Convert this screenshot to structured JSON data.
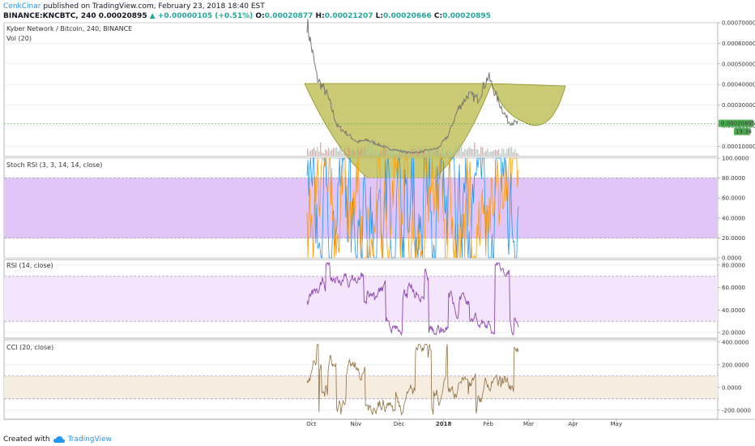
{
  "header": {
    "user": "CenkCinar",
    "published": "published on TradingView.com, February 23, 2018 18:40 EST",
    "symbol": "BINANCE:KNCBTC, 240",
    "change_arrow": "▲",
    "change": "+0.00000105 (+0.51%)",
    "last": "0.00020895",
    "o_label": "O:",
    "o": "0.00020877",
    "h_label": "H:",
    "h": "0.00021207",
    "l_label": "L:",
    "l": "0.00020666",
    "c_label": "C:",
    "c": "0.00020895"
  },
  "panes": {
    "price_title": "Kyber Network / Bitcoin, 240, BINANCE",
    "vol_title": "Vol (20)",
    "stoch_title": "Stoch RSI (3, 3, 14, 14, close)",
    "rsi_title": "RSI (14, close)",
    "cci_title": "CCI (20, close)"
  },
  "badges": {
    "price": "0.00020895",
    "time": "19:34"
  },
  "footer": {
    "created": "Created with",
    "brand": "TradingView"
  },
  "colors": {
    "price_line": "#777777",
    "cup_fill": "#b5b53c",
    "stoch_band": "#e2c5f7",
    "rsi_band": "#f3e5fb",
    "cci_band": "#f5ede0",
    "stoch_k": "#2196f3",
    "stoch_d": "#ff9800",
    "rsi_line": "#8e44ad",
    "cci_line": "#8d6e3f",
    "badge_green": "#4caf50"
  },
  "chart_data": [
    {
      "type": "line",
      "title": "Kyber Network / Bitcoin, 240, BINANCE",
      "x": [
        "2017-09-28",
        "2017-10-05",
        "2017-10-12",
        "2017-10-19",
        "2017-10-26",
        "2017-11-02",
        "2017-11-09",
        "2017-11-16",
        "2017-11-23",
        "2017-11-30",
        "2017-12-07",
        "2017-12-14",
        "2017-12-21",
        "2017-12-28",
        "2018-01-04",
        "2018-01-11",
        "2018-01-18",
        "2018-01-25",
        "2018-02-01",
        "2018-02-08",
        "2018-02-15",
        "2018-02-22"
      ],
      "series": [
        {
          "values": [
            0.0007,
            0.00043,
            0.00035,
            0.0002,
            0.00016,
            0.00012,
            0.00013,
            0.00011,
            9e-05,
            8e-05,
            7e-05,
            7e-05,
            8e-05,
            9e-05,
            0.00015,
            0.00028,
            0.00035,
            0.00033,
            0.00044,
            0.00032,
            0.00022,
            0.00021
          ]
        }
      ],
      "ylim": [
        5e-05,
        0.0007
      ],
      "yticks": [
        "0.00010000",
        "0.00020000",
        "0.00030000",
        "0.00040000",
        "0.00050000",
        "0.00060000",
        "0.00070000"
      ],
      "xticks": [
        "Oct",
        "Nov",
        "Dec",
        "2018",
        "Feb",
        "Mar",
        "Apr",
        "May"
      ]
    },
    {
      "type": "line",
      "title": "Stoch RSI (3, 3, 14, 14, close)",
      "ylim": [
        0,
        100
      ],
      "yticks": [
        "0.0000",
        "20.0000",
        "40.0000",
        "60.0000",
        "80.0000",
        "100.0000"
      ],
      "band": [
        20,
        80
      ]
    },
    {
      "type": "line",
      "title": "RSI (14, close)",
      "ylim": [
        15,
        85
      ],
      "yticks": [
        "20.0000",
        "40.0000",
        "60.0000",
        "80.0000"
      ],
      "band": [
        30,
        70
      ]
    },
    {
      "type": "line",
      "title": "CCI (20, close)",
      "ylim": [
        -280,
        420
      ],
      "yticks": [
        "-200.0000",
        "0.0000",
        "200.0000",
        "400.0000"
      ],
      "band": [
        -100,
        100
      ]
    }
  ]
}
